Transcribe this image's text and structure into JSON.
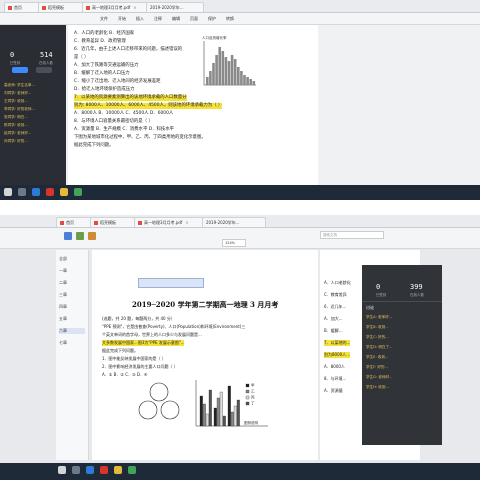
{
  "top_window": {
    "tabs": [
      {
        "label": "首页"
      },
      {
        "label": "稻壳模板"
      },
      {
        "label": "高一地理3月月考.pdf"
      },
      {
        "label": "2019-2020学年..."
      }
    ],
    "toolbar": [
      "文件",
      "开始",
      "插入",
      "注释",
      "编辑",
      "页面",
      "保护",
      "转换"
    ],
    "timer": {
      "a": "0",
      "b": "514",
      "a_label": "已签到",
      "b_label": "在线人数"
    },
    "panel_items": [
      "高老师: 学生名单...",
      "刘同学: 老师好...",
      "王同学: 收到...",
      "李同学: 好的老师...",
      "张同学: 明白...",
      "陈同学: 收到...",
      "赵同学: 老师好...",
      "孙同学: 好的..."
    ],
    "question_lines": [
      {
        "text": "A．人口的老龄化    B．经济国家",
        "hl": false
      },
      {
        "text": "C．教育差异       D．政府管理",
        "hl": false
      },
      {
        "text": "6．近几年，由于上述人口迁移带来的问题，描述错误的",
        "hl": false
      },
      {
        "text": "是（  ）",
        "hl": false
      },
      {
        "text": "A．加大了铁路等交通运输的压力",
        "hl": false
      },
      {
        "text": "B．缓解了迁入地的人口压力",
        "hl": false
      },
      {
        "text": "C．缩小了迁出地、迁入地间的经济发展差距",
        "hl": false
      },
      {
        "text": "D．给迁入地环境保护造成压力",
        "hl": false
      },
      {
        "text": "7．以某地的资源要素测算出的该地环境承载的人口数量分",
        "hl": true
      },
      {
        "text": "别为: 8000人、10000人、6000人、4500人，则该地的环境承载力为（  ）",
        "hl": true
      },
      {
        "text": "A．8000人  B．10000人  C．4500人  D．6000人",
        "hl": false
      },
      {
        "text": "8．与环境人口容量关系最密切的是（  ）",
        "hl": false
      },
      {
        "text": "A．资源量   B．生产规模   C．消费水平   D．科技水平",
        "hl": false
      },
      {
        "text": "下图为某地城市化过程中，甲、乙、丙、丁四类用地的变化示意图。",
        "hl": false
      },
      {
        "text": "据此完成下列问题。",
        "hl": false
      }
    ],
    "chart_label": "人口自然增长率"
  },
  "bottom_window": {
    "tabs": [
      {
        "label": "首页"
      },
      {
        "label": "稻壳模板"
      },
      {
        "label": "高一地理3月月考.pdf"
      },
      {
        "label": "2019-2020学年..."
      }
    ],
    "search_placeholder": "搜索文档",
    "zoom": "124%",
    "page_title": "2019─2020 学年第二学期高一地理 3 月月考",
    "doc_lines": [
      {
        "text": "(选题，共 20 题，每题两分，共 40 分）",
        "hl": false
      },
      {
        "text": "\"PPE 预测\"，它是由普查(Poverty)、人口(Population)和环境(Environment)三",
        "hl": false
      },
      {
        "text": "个英文单词的首字母，世界上的人口多少与发展问题是...",
        "hl": false
      },
      {
        "text": "大多数发展中国家...图3为\"PPE 发展示意图\"...",
        "hl": true
      },
      {
        "text": "据此完成下列问题。",
        "hl": false
      },
      {
        "text": "1．图中能反映发展中国家的是（  ）",
        "hl": false
      },
      {
        "text": "2．图中影响经济发展的主要人口问题（  ）",
        "hl": false
      },
      {
        "text": "A．①       B．②       C．③       D．④",
        "hl": false
      }
    ],
    "legend": [
      "甲",
      "乙",
      "丙",
      "丁"
    ],
    "chart_caption": "图例说明",
    "side_panel": {
      "a": "0",
      "b": "399",
      "a_label": "已签到",
      "b_label": "在线人数",
      "title": "讨论",
      "items": [
        "学生A: 老师好...",
        "学生B: 收到...",
        "学生C: 好的...",
        "学生D: 明白了...",
        "学生E: 收到...",
        "学生F: 好的...",
        "学生G: 老师好...",
        "学生H: 收到..."
      ]
    },
    "right_doc_lines": [
      {
        "text": "A．人口老龄化",
        "hl": false
      },
      {
        "text": "C．教育差异",
        "hl": false
      },
      {
        "text": "6．近几年...",
        "hl": false
      },
      {
        "text": "A．加大...",
        "hl": false
      },
      {
        "text": "B．缓解...",
        "hl": false
      },
      {
        "text": "7．以某地的...",
        "hl": true
      },
      {
        "text": "别为8000人...",
        "hl": true
      },
      {
        "text": "A．8000人",
        "hl": false
      },
      {
        "text": "8．与环境...",
        "hl": false
      },
      {
        "text": "A．资源量",
        "hl": false
      }
    ]
  },
  "left_nav": [
    "全部",
    "一章",
    "二章",
    "三章",
    "四章",
    "五章",
    "六章",
    "七章"
  ]
}
